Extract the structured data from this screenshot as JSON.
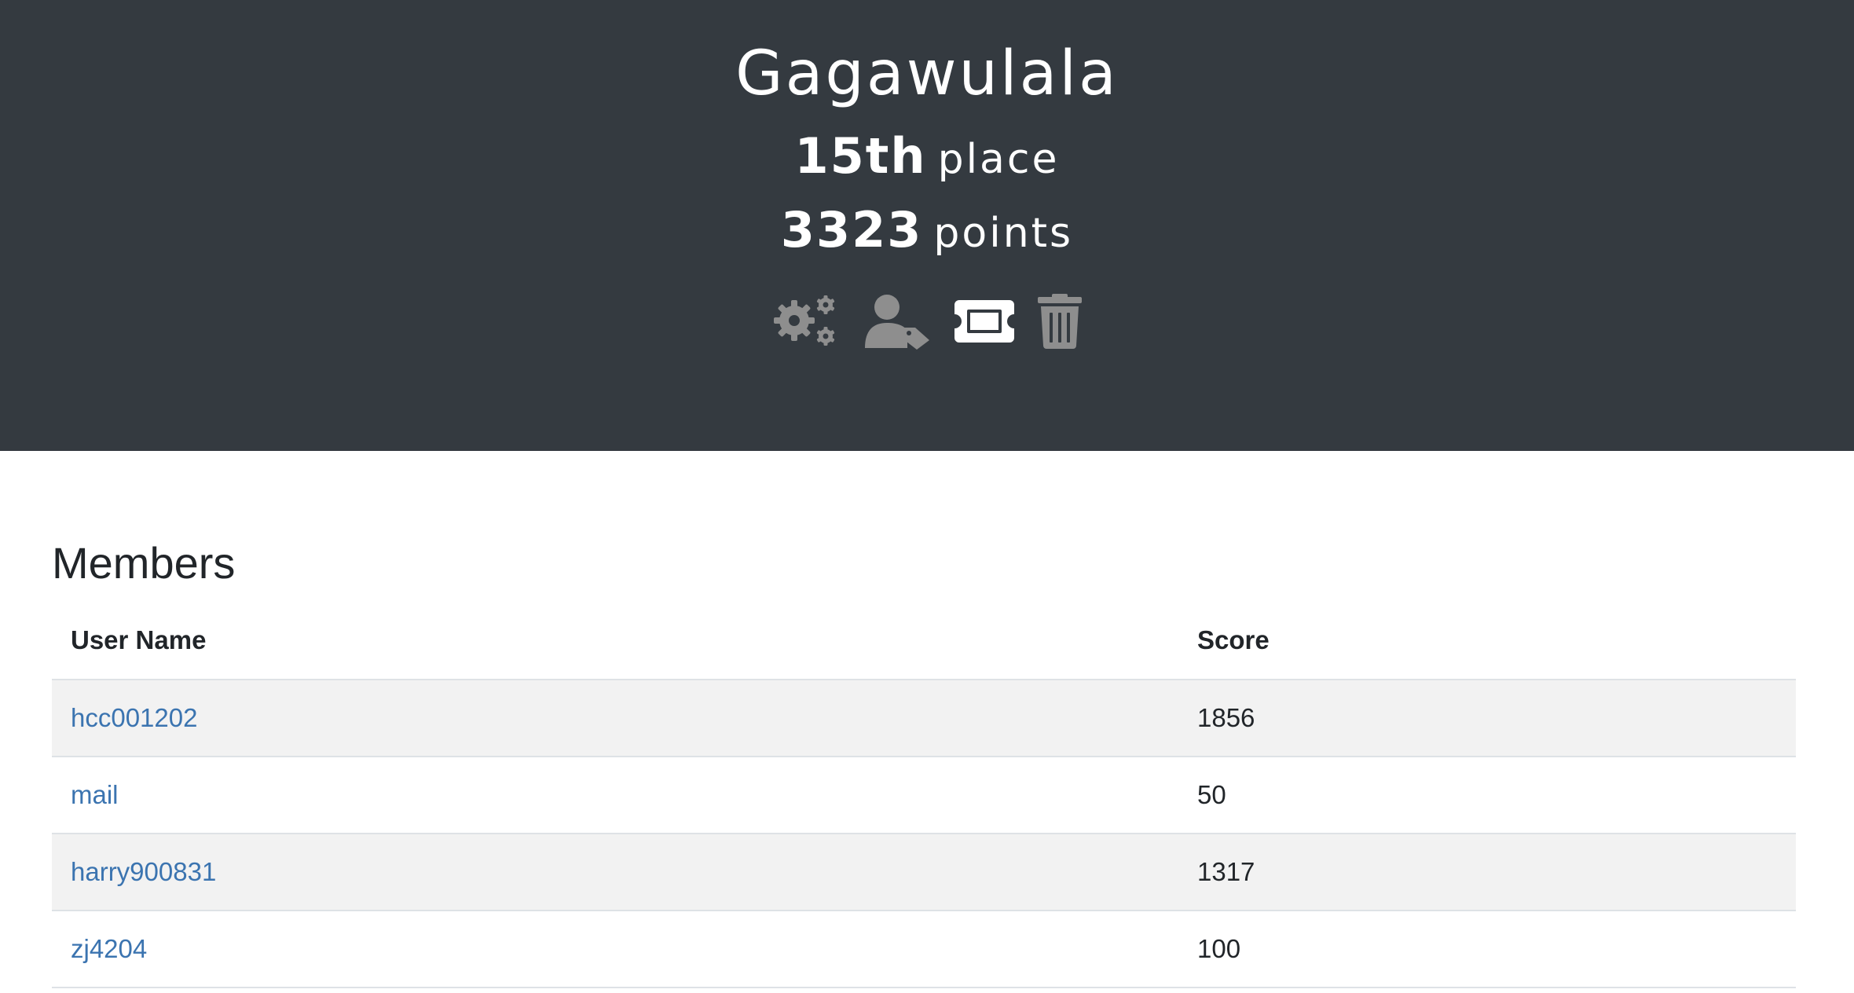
{
  "team": {
    "name": "Gagawulala",
    "place_value": "15th",
    "place_label": "place",
    "points_value": "3323",
    "points_label": "points"
  },
  "actions": [
    {
      "icon": "gears-icon",
      "label": "Manage team"
    },
    {
      "icon": "user-tag-icon",
      "label": "Members"
    },
    {
      "icon": "ticket-icon",
      "label": "Invite"
    },
    {
      "icon": "trash-icon",
      "label": "Delete"
    }
  ],
  "colors": {
    "hero_bg": "#343a40",
    "icon_gray": "#8e8e8e",
    "link": "#3b74b0",
    "stripe": "#f2f2f2"
  },
  "members": {
    "title": "Members",
    "columns": [
      "User Name",
      "Score"
    ],
    "rows": [
      {
        "user": "hcc001202",
        "score": "1856"
      },
      {
        "user": "mail",
        "score": "50"
      },
      {
        "user": "harry900831",
        "score": "1317"
      },
      {
        "user": "zj4204",
        "score": "100"
      }
    ]
  }
}
